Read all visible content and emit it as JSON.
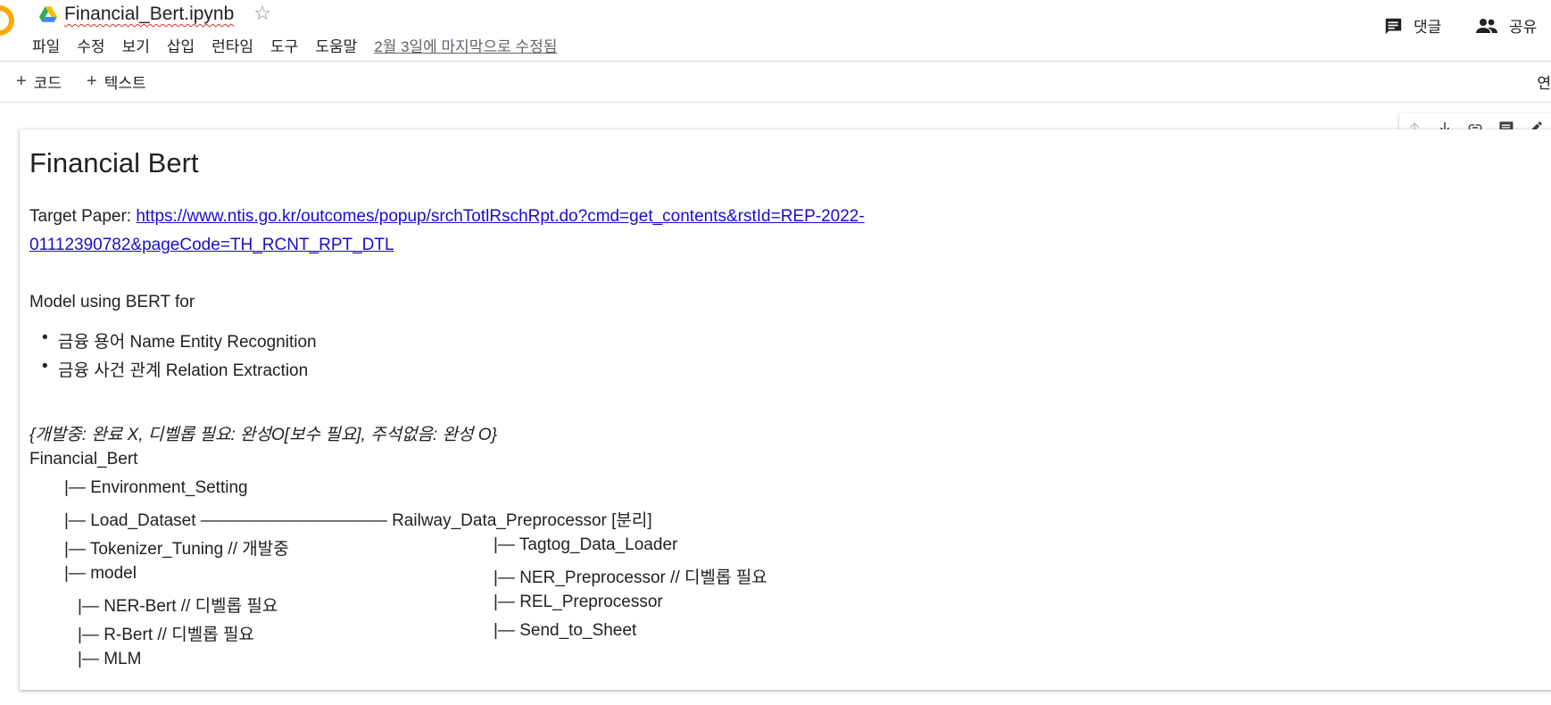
{
  "header": {
    "doc_title": "Financial_Bert.ipynb",
    "menu": [
      "파일",
      "수정",
      "보기",
      "삽입",
      "런타임",
      "도구",
      "도움말"
    ],
    "last_edit": "2월 3일에 마지막으로 수정됨",
    "comment_label": "댓글",
    "share_label": "공유"
  },
  "toolbar": {
    "add_code": "코드",
    "add_text": "텍스트",
    "connect": "연"
  },
  "cell": {
    "title": "Financial Bert",
    "target_label": "Target Paper: ",
    "target_url_line1": "https://www.ntis.go.kr/outcomes/popup/srchTotlRschRpt.do?cmd=get_contents&rstId=REP-2022-",
    "target_url_line2": "01112390782&pageCode=TH_RCNT_RPT_DTL",
    "model_intro": "Model using BERT for",
    "bullets": [
      "금융 용어 Name Entity Recognition",
      "금융 사건 관계 Relation Extraction"
    ],
    "status_note": "{개발중: 완료 X, 디벨롭 필요: 완성O[보수 필요], 주석없음: 완성 O}",
    "tree": {
      "root": "Financial_Bert",
      "left": [
        "|— Environment_Setting",
        "|— Load_Dataset ——————————— Railway_Data_Preprocessor [분리]",
        "|— Tokenizer_Tuning // 개발중",
        "|— model",
        "|— NER-Bert // 디벨롭 필요",
        "|— R-Bert // 디벨롭 필요",
        "|— MLM"
      ],
      "right": [
        "|— Tagtog_Data_Loader",
        "|— NER_Preprocessor // 디벨롭 필요",
        "|— REL_Preprocessor",
        "|— Send_to_Sheet"
      ]
    }
  },
  "icons": {
    "drive": "google-drive-icon",
    "star": "star-outline-icon",
    "comment": "comment-icon",
    "share": "people-icon",
    "cell_toolbar": [
      "arrow-up-icon",
      "arrow-down-icon",
      "link-icon",
      "comment-icon",
      "edit-pencil-icon"
    ]
  },
  "colors": {
    "link": "#1a0dcc",
    "logo": "#f9ab00",
    "divider": "#dadce0"
  }
}
